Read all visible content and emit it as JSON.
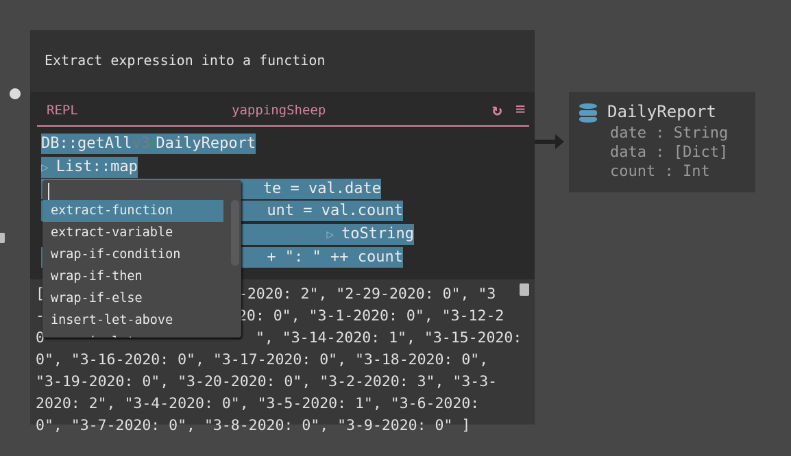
{
  "title": "Extract expression into a function",
  "repl": {
    "label": "REPL",
    "name": "yappingSheep",
    "icons": [
      "refresh-icon",
      "menu-icon"
    ],
    "code": {
      "line1_fn": "DB::getAll",
      "line1_version": "v3",
      "line1_arg": "DailyReport",
      "line2": "List::map",
      "line3": "te = val.date",
      "line4": "unt = val.count",
      "line5": "toString",
      "line6": "+ \": \" ++ count"
    }
  },
  "output": {
    "lines": [
      [
        "[",
        "8-2020: 2\", \"2-29-2020: 0\", \"3"
      ],
      [
        "-",
        "20: 0\", \"3-1-2020: 0\", \"3-12-2"
      ],
      [
        "0",
        "\", \"3-14-2020: 1\", \"3-15-2020:"
      ],
      [
        "",
        "0\", \"3-16-2020: 0\", \"3-17-2020: 0\", \"3-18-2020: 0\","
      ],
      [
        "",
        "\"3-19-2020: 0\", \"3-20-2020: 0\", \"3-2-2020: 3\", \"3-3-"
      ],
      [
        "",
        "2020: 2\", \"3-4-2020: 0\", \"3-5-2020: 1\", \"3-6-2020:"
      ],
      [
        "",
        "0\", \"3-7-2020: 0\", \"3-8-2020: 0\", \"3-9-2020: 0\" ]"
      ]
    ]
  },
  "dropdown": {
    "input_value": "",
    "items": [
      "extract-function",
      "extract-variable",
      "wrap-if-condition",
      "wrap-if-then",
      "wrap-if-else",
      "insert-let-above",
      "wrap-in-let"
    ],
    "selected": "extract-function"
  },
  "db": {
    "name": "DailyReport",
    "fields": [
      "date : String",
      "data : [Dict]",
      "count : Int"
    ]
  },
  "colors": {
    "accent": "#d4849b",
    "highlight": "#4a7f9a",
    "db_icon": "#5b9bbf"
  }
}
